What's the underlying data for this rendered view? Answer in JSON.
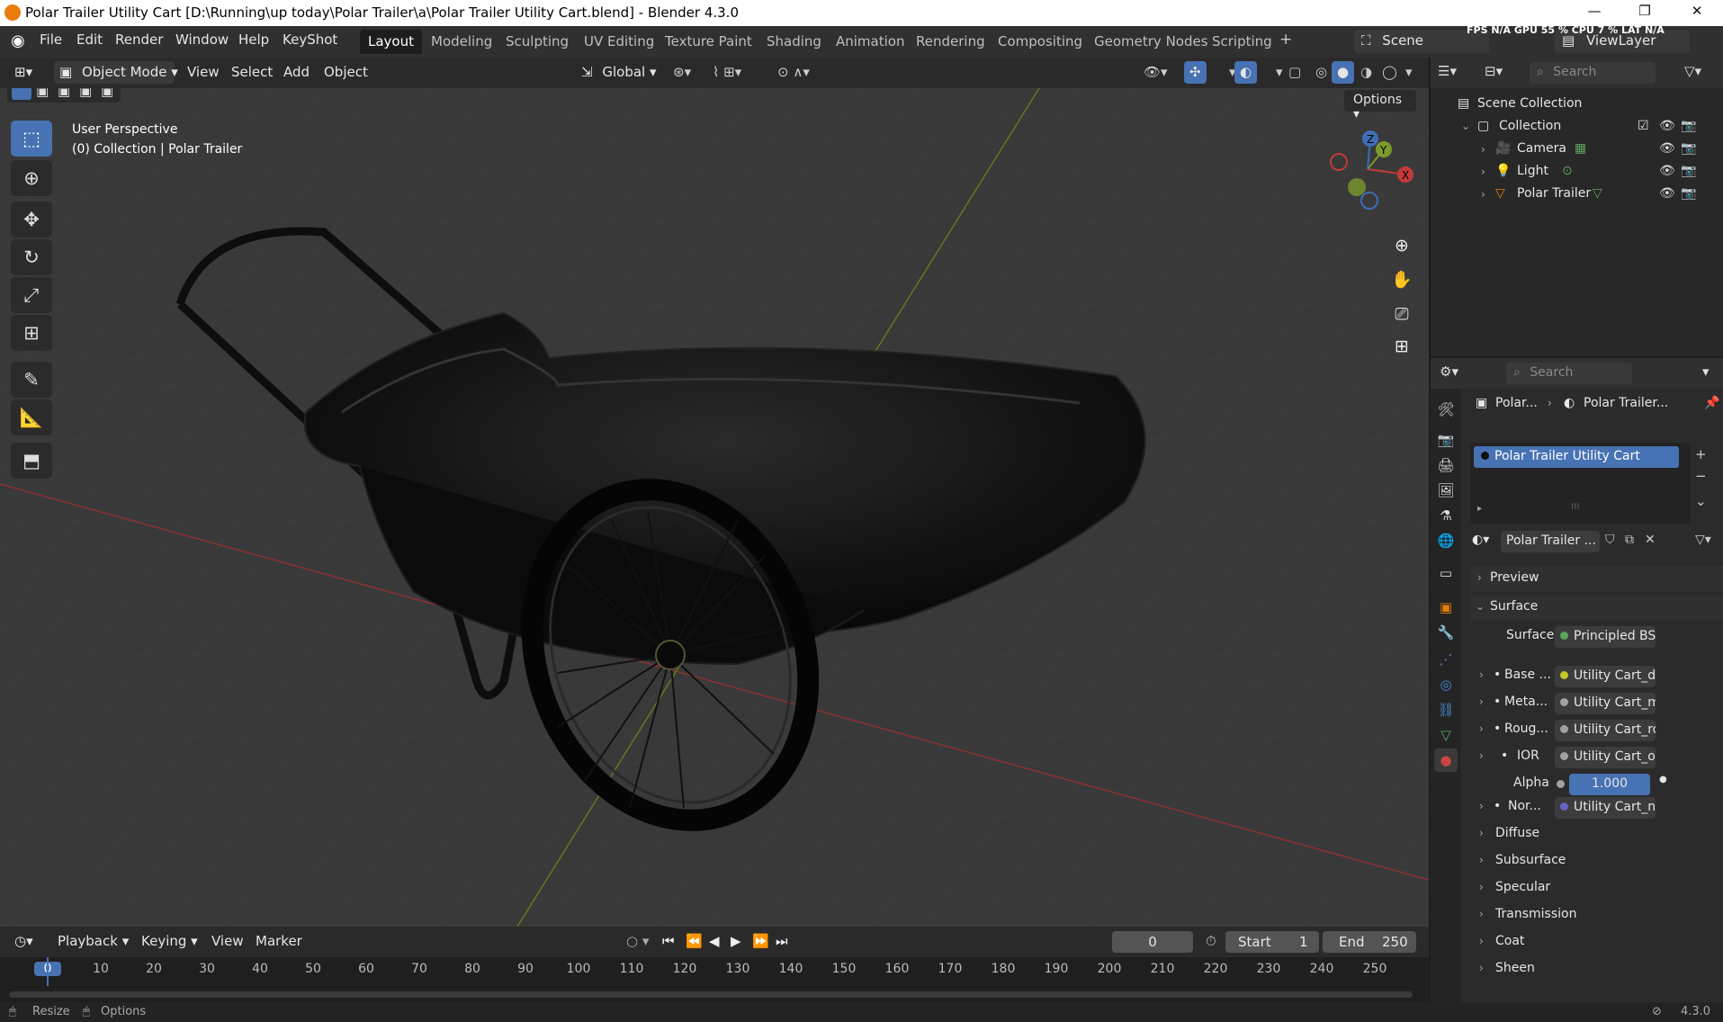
{
  "window": {
    "title": "Polar Trailer Utility Cart [D:\\Running\\up today\\Polar Trailer\\a\\Polar Trailer Utility Cart.blend] - Blender 4.3.0",
    "min": "—",
    "max": "❐",
    "close": "✕"
  },
  "menus": [
    "File",
    "Edit",
    "Render",
    "Window",
    "Help",
    "KeyShot"
  ],
  "workspaces": [
    "Layout",
    "Modeling",
    "Sculpting",
    "UV Editing",
    "Texture Paint",
    "Shading",
    "Animation",
    "Rendering",
    "Compositing",
    "Geometry Nodes",
    "Scripting"
  ],
  "topright": {
    "scene": "Scene",
    "viewlayer": "ViewLayer",
    "stats": "FPS  N/A  GPU  55 %  CPU  7 %  LAT  N/A"
  },
  "viewport_header": {
    "mode": "Object Mode",
    "menus": [
      "View",
      "Select",
      "Add",
      "Object"
    ],
    "transform": "Global",
    "options": "Options"
  },
  "viewport": {
    "perspective": "User Perspective",
    "collection": "(0) Collection | Polar Trailer",
    "gizmo": {
      "x": "X",
      "y": "Y",
      "z": "Z"
    }
  },
  "outliner": {
    "search_placeholder": "Search",
    "scene_collection": "Scene Collection",
    "collection": "Collection",
    "items": [
      "Camera",
      "Light",
      "Polar Trailer"
    ]
  },
  "properties": {
    "search_placeholder": "Search",
    "breadcrumb_object": "Polar...",
    "breadcrumb_material": "Polar Trailer...",
    "material_slot": "Polar Trailer Utility Cart",
    "material_name": "Polar Trailer ...",
    "panels": {
      "preview": "Preview",
      "surface": "Surface"
    },
    "surface_label": "Surface",
    "surface_value": "Principled BSDF",
    "inputs": [
      {
        "label": "Base ...",
        "value": "Utility Cart_dif...",
        "color": "#c7c729"
      },
      {
        "label": "Meta...",
        "value": "Utility Cart_m...",
        "color": "#a1a1a1"
      },
      {
        "label": "Roug...",
        "value": "Utility Cart_ro...",
        "color": "#a1a1a1"
      },
      {
        "label": "IOR",
        "value": "Utility Cart_oc...",
        "color": "#a1a1a1"
      }
    ],
    "alpha_label": "Alpha",
    "alpha_value": "1.000",
    "normal": {
      "label": "Nor...",
      "value": "Utility Cart_no...",
      "color": "#6363c7"
    },
    "subpanels": [
      "Diffuse",
      "Subsurface",
      "Specular",
      "Transmission",
      "Coat",
      "Sheen"
    ]
  },
  "timeline": {
    "menus": [
      "Playback",
      "Keying",
      "View",
      "Marker"
    ],
    "current_frame": "0",
    "start_label": "Start",
    "start": "1",
    "end_label": "End",
    "end": "250",
    "ruler": [
      "0",
      "10",
      "20",
      "30",
      "40",
      "50",
      "60",
      "70",
      "80",
      "90",
      "100",
      "110",
      "120",
      "130",
      "140",
      "150",
      "160",
      "170",
      "180",
      "190",
      "200",
      "210",
      "220",
      "230",
      "240",
      "250"
    ]
  },
  "status": {
    "left1": "Resize",
    "left2": "Options",
    "version": "4.3.0"
  },
  "colors": {
    "accent": "#4772b3",
    "x_axis": "#c43a3a",
    "y_axis": "#7a9a2c"
  }
}
